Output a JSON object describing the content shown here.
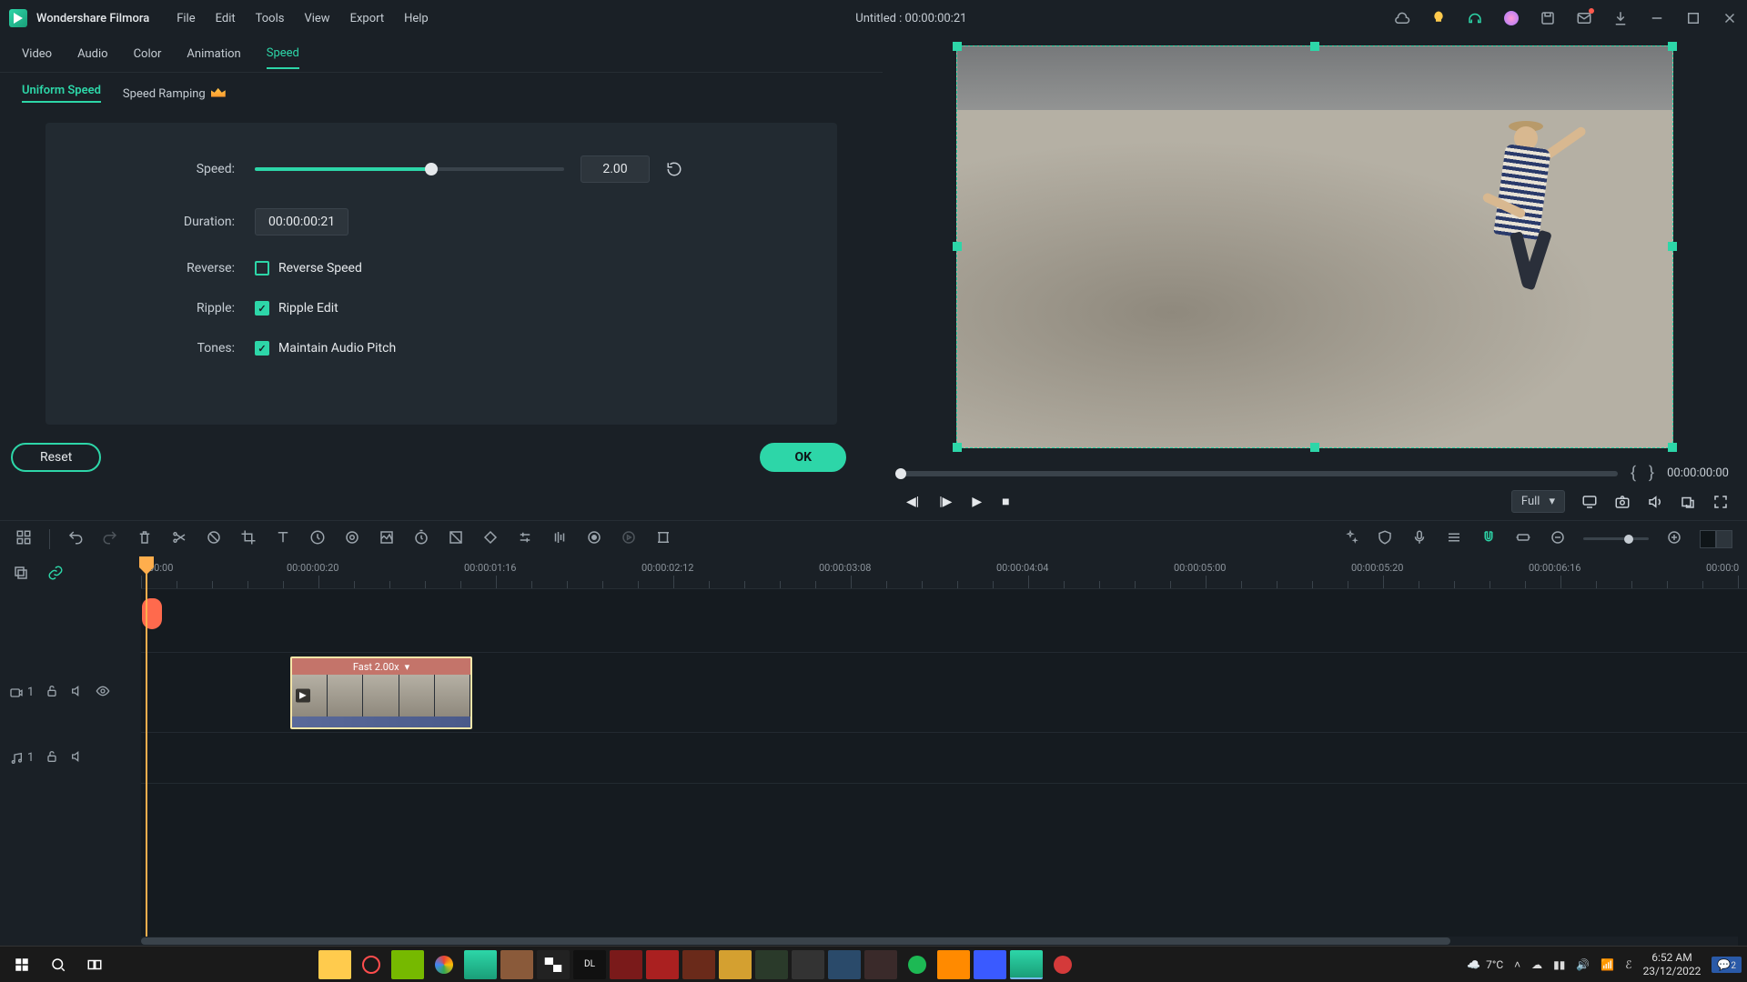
{
  "app": {
    "name": "Wondershare Filmora"
  },
  "menu": [
    "File",
    "Edit",
    "Tools",
    "View",
    "Export",
    "Help"
  ],
  "title_center": "Untitled : 00:00:00:21",
  "prop_tabs": [
    "Video",
    "Audio",
    "Color",
    "Animation",
    "Speed"
  ],
  "prop_active": "Speed",
  "sub_tabs": {
    "uniform": "Uniform Speed",
    "ramping": "Speed Ramping"
  },
  "speed": {
    "label": "Speed:",
    "value": "2.00",
    "duration_label": "Duration:",
    "duration_value": "00:00:00:21",
    "reverse_label": "Reverse:",
    "reverse_opt": "Reverse Speed",
    "ripple_label": "Ripple:",
    "ripple_opt": "Ripple Edit",
    "tones_label": "Tones:",
    "tones_opt": "Maintain Audio Pitch"
  },
  "buttons": {
    "reset": "Reset",
    "ok": "OK"
  },
  "preview": {
    "mark_in": "{",
    "mark_out": "}",
    "timecode": "00:00:00:00",
    "quality": "Full"
  },
  "ruler": {
    "labels": [
      "00:00",
      "00:00:00:20",
      "00:00:01:16",
      "00:00:02:12",
      "00:00:03:08",
      "00:00:04:04",
      "00:00:05:00",
      "00:00:05:20",
      "00:00:06:16",
      "00:00:0"
    ]
  },
  "clip": {
    "label": "Fast 2.00x"
  },
  "track": {
    "video": "1",
    "audio": "1"
  },
  "system": {
    "temp": "7°C",
    "time": "6:52 AM",
    "date": "23/12/2022",
    "notif": "2"
  }
}
